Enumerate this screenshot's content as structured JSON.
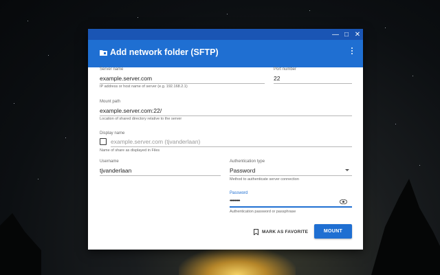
{
  "dialog": {
    "title": "Add network folder (SFTP)",
    "window_controls": [
      "minimize",
      "maximize",
      "close"
    ],
    "accent_color": "#1f6fd2"
  },
  "server_name": {
    "label": "Server name",
    "value": "example.server.com",
    "hint": "IP address or host name of server (e.g. 192.168.2.1)"
  },
  "port": {
    "label": "Port number",
    "value": "22"
  },
  "mount_path": {
    "label": "Mount path",
    "value": "example.server.com:22/",
    "hint": "Location of shared directory relative to the server"
  },
  "display_name": {
    "label": "Display name",
    "placeholder": "example.server.com (tjvanderlaan)",
    "hint": "Name of share as displayed in Files",
    "checked": false
  },
  "username": {
    "label": "Username",
    "value": "tjvanderlaan"
  },
  "auth_type": {
    "label": "Authentication type",
    "value": "Password",
    "hint": "Method to authenticate server connection"
  },
  "password": {
    "label": "Password",
    "value": "••••••••••",
    "hint": "Authentication password or passphrase",
    "icon": "eye-icon"
  },
  "actions": {
    "favorite_label": "MARK AS FAVORITE",
    "mount_label": "MOUNT"
  }
}
